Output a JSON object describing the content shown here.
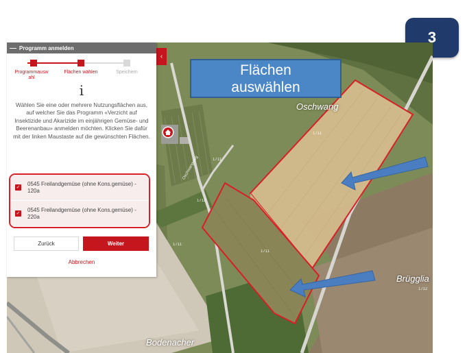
{
  "step_badge": "3",
  "callout": "Flächen\nauswählen",
  "panel": {
    "header": "Programm anmelden",
    "collapse_glyph": "‹",
    "steps": [
      {
        "label": "Programmausw ahl",
        "state": "done"
      },
      {
        "label": "Flächen wählen",
        "state": "active"
      },
      {
        "label": "Speichern",
        "state": "pending"
      }
    ],
    "info_icon": "i",
    "info_text": "Wählen Sie eine oder mehrere Nutzungsflächen aus, auf welcher Sie das Programm «Verzicht auf Insektizide und Akarizide im einjährigen Gemüse- und Beerenanbau» anmelden möchten. Klicken Sie dafür mit der linken Maustaste auf die gewünschten Flächen.",
    "fields": [
      {
        "label": "0545 Freilandgemüse (ohne Kons.gemüse) - 120a",
        "checked": true
      },
      {
        "label": "0545 Freilandgemüse (ohne Kons.gemüse) - 220a",
        "checked": true
      }
    ],
    "back_label": "Zurück",
    "next_label": "Weiter",
    "cancel_label": "Abbrechen"
  },
  "map": {
    "places": [
      "Oschwang",
      "Brügglia",
      "Bodenacher"
    ],
    "parcel_numbers": [
      "1711",
      "1711",
      "1712",
      "1711",
      "1711",
      "1712"
    ],
    "road_label": "Oschwangweg"
  },
  "colors": {
    "accent_red": "#c4161c",
    "badge_blue": "#1f3a6b",
    "callout_blue": "#4b86c6",
    "arrow_blue": "#4a7ec0"
  },
  "icons": [
    "home-marker-icon",
    "checkbox-checked-icon",
    "info-icon"
  ]
}
